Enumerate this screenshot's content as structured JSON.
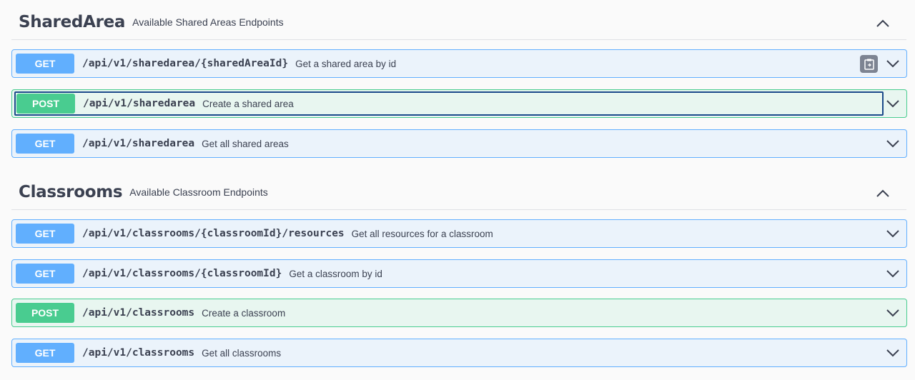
{
  "sections": [
    {
      "title": "SharedArea",
      "description": "Available Shared Areas Endpoints",
      "operations": [
        {
          "method": "GET",
          "path": "/api/v1/sharedarea/{sharedAreaId}",
          "summary": "Get a shared area by id"
        },
        {
          "method": "POST",
          "path": "/api/v1/sharedarea",
          "summary": "Create a shared area"
        },
        {
          "method": "GET",
          "path": "/api/v1/sharedarea",
          "summary": "Get all shared areas"
        }
      ]
    },
    {
      "title": "Classrooms",
      "description": "Available Classroom Endpoints",
      "operations": [
        {
          "method": "GET",
          "path": "/api/v1/classrooms/{classroomId}/resources",
          "summary": "Get all resources for a classroom"
        },
        {
          "method": "GET",
          "path": "/api/v1/classrooms/{classroomId}",
          "summary": "Get a classroom by id"
        },
        {
          "method": "POST",
          "path": "/api/v1/classrooms",
          "summary": "Create a classroom"
        },
        {
          "method": "GET",
          "path": "/api/v1/classrooms",
          "summary": "Get all classrooms"
        }
      ]
    }
  ],
  "icons": {
    "collapse": "chevron-up-icon",
    "expand": "chevron-down-icon",
    "copy": "clipboard-icon"
  },
  "colors": {
    "get": "#61affe",
    "post": "#49cc90",
    "focus": "#1b4a8a"
  }
}
